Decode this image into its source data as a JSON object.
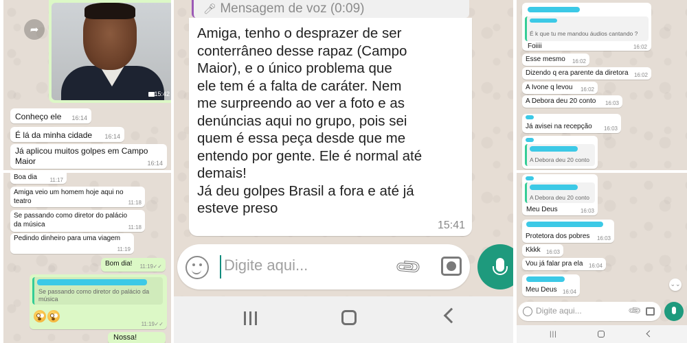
{
  "panelA": {
    "photo_time": "15:42",
    "messages": [
      {
        "text": "Conheço ele",
        "time": "16:14"
      },
      {
        "text": "É lá da minha cidade",
        "time": "16:14"
      },
      {
        "text": "Já aplicou muitos golpes em Campo Maior",
        "time": "16:14"
      }
    ]
  },
  "panelB": {
    "messages": [
      {
        "text": "Boa dia",
        "time": "11:17"
      },
      {
        "text": "Amiga veio um homem hoje aqui no teatro",
        "time": "11:18"
      },
      {
        "text": "Se passando como diretor do palácio da música",
        "time": "11:18"
      },
      {
        "text": "Pedindo dinheiro para uma viagem",
        "time": "11:19"
      }
    ],
    "outgoing": [
      {
        "text": "Bom dia!",
        "time": "11:19",
        "ticks": "✓✓"
      },
      {
        "quote": "Se passando como diretor do palácio da música",
        "time": "11:19",
        "ticks": "✓✓"
      },
      {
        "text": "Nossa!"
      }
    ]
  },
  "panelC": {
    "voice_header": "Mensagem de voz (0:09)",
    "message_text": "Amiga, tenho o desprazer de ser\nconterrâneo desse rapaz (Campo\nMaior), e o único problema que\nele tem é a falta de caráter. Nem\nme surpreendo ao ver a foto e as\ndenúncias aqui no grupo, pois sei\nquem é essa peça desde que me\nentendo por gente. Ele é normal até\ndemais!\nJá deu golpes Brasil a fora e até já\nesteve preso",
    "message_time": "15:41",
    "input_placeholder": "Digite aqui..."
  },
  "panelD": {
    "quote": "É k que tu me mandou áudios cantando ?",
    "messages": [
      {
        "text": "Foiiii",
        "time": "16:02"
      },
      {
        "text": "Esse mesmo",
        "time": "16:02"
      },
      {
        "text": "Dizendo q era parente da diretora",
        "time": "16:02"
      },
      {
        "text": "A Ivone q levou",
        "time": "16:02"
      },
      {
        "text": "A Debora deu 20 conto",
        "time": "16:03"
      },
      {
        "text": "Já avisei na recepção",
        "time": "16:03"
      }
    ],
    "reply_quote": "A Debora deu 20 conto"
  },
  "panelE": {
    "reply_quote": "A Debora deu 20 conto",
    "messages": [
      {
        "text": "Meu Deus",
        "time": "16:03"
      },
      {
        "text": "Protetora dos pobres",
        "time": "16:03"
      },
      {
        "text": "Kkkk",
        "time": "16:03"
      },
      {
        "text": "Vou já falar pra ela",
        "time": "16:04"
      },
      {
        "text": "Meu Deus",
        "time": "16:04"
      }
    ],
    "input_placeholder": "Digite aqui..."
  }
}
